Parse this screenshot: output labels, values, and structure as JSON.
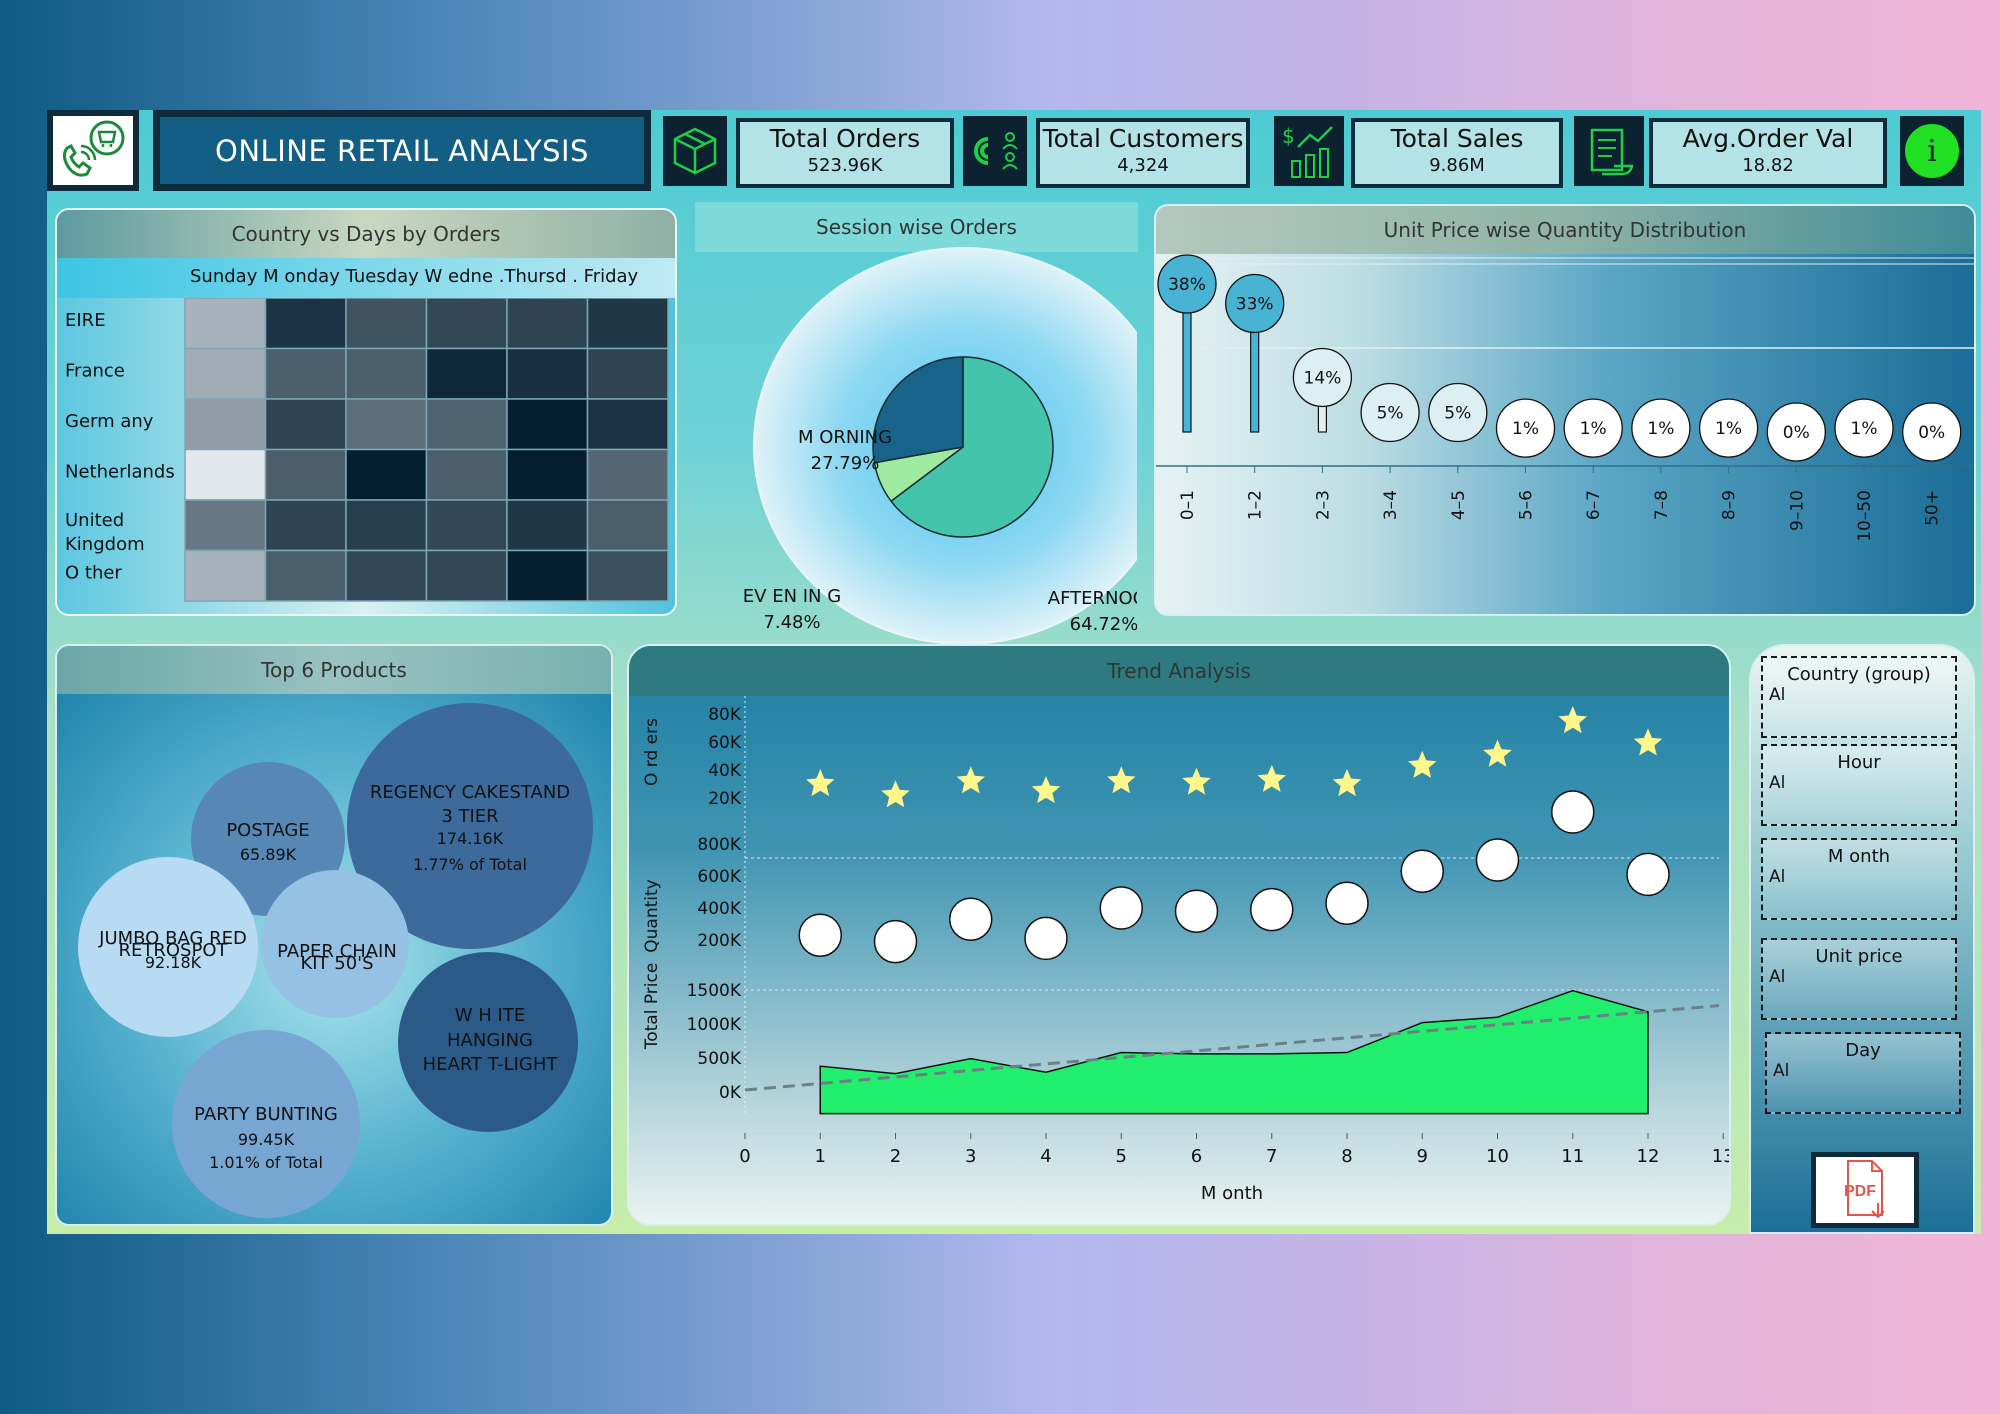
{
  "header": {
    "title": "ONLINE RETAIL ANALYSIS",
    "kpis": [
      {
        "label": "Total Orders",
        "value": "523.96K"
      },
      {
        "label": "Total Customers",
        "value": "4,324"
      },
      {
        "label": "Total Sales",
        "value": "9.86M"
      },
      {
        "label": "Avg.Order Val",
        "value": "18.82"
      }
    ],
    "info_glyph": "i"
  },
  "heatmap": {
    "title": "Country vs Days by Orders",
    "days_header": "Sunday M onday Tuesday W edne .Thursd . Friday",
    "rows": [
      {
        "label": "EIRE",
        "shades": [
          0.3,
          0.9,
          0.75,
          0.8,
          0.82,
          0.88
        ]
      },
      {
        "label": "France",
        "shades": [
          0.33,
          0.7,
          0.7,
          0.95,
          0.92,
          0.82
        ]
      },
      {
        "label": "Germ any",
        "shades": [
          0.4,
          0.82,
          0.62,
          0.68,
          1.0,
          0.9
        ]
      },
      {
        "label": "Netherlands",
        "shades": [
          0.05,
          0.7,
          1.0,
          0.7,
          1.0,
          0.66
        ]
      },
      {
        "label": "United Kingdom",
        "shades": [
          0.58,
          0.82,
          0.85,
          0.8,
          0.88,
          0.7
        ]
      },
      {
        "label": "O ther",
        "shades": [
          0.3,
          0.7,
          0.8,
          0.8,
          1.0,
          0.76
        ]
      }
    ]
  },
  "session": {
    "title": "Session wise Orders",
    "slices": [
      {
        "name": "AFTERNOON",
        "pct": "64.72%",
        "value": 64.72,
        "color": "#45c4ac"
      },
      {
        "name": "EV EN IN G",
        "pct": "7.48%",
        "value": 7.48,
        "color": "#9eeaa0"
      },
      {
        "name": "M ORNING",
        "pct": "27.79%",
        "value": 27.79,
        "color": "#17638a"
      }
    ]
  },
  "unitprice": {
    "title": "Unit Price wise Quantity Distribution",
    "categories": [
      "0–1",
      "1–2",
      "2–3",
      "3–4",
      "4–5",
      "5–6",
      "6–7",
      "7–8",
      "8–9",
      "9–10",
      "10–50",
      "50+"
    ],
    "labels": [
      "38%",
      "33%",
      "14%",
      "5%",
      "5%",
      "1%",
      "1%",
      "1%",
      "1%",
      "0%",
      "1%",
      "0%"
    ],
    "values": [
      38,
      33,
      14,
      5,
      5,
      1,
      1,
      1,
      1,
      0,
      1,
      0
    ]
  },
  "products": {
    "title": "Top 6 Products",
    "items": [
      {
        "name": "POSTAGE",
        "value": "65.89K",
        "pct": ""
      },
      {
        "name": "REGENCY CAKESTAND 3 TIER",
        "value": "174.16K",
        "pct": "1.77% of Total"
      },
      {
        "name": "JUMBO BAG RED RETROSPOT",
        "value": "92.18K",
        "pct": ""
      },
      {
        "name": "PAPER CHAIN KIT 50'S",
        "value": "",
        "pct": ""
      },
      {
        "name": "W H ITE HANGING HEART T-LIGHT",
        "value": "",
        "pct": ""
      },
      {
        "name": "PARTY BUNTING",
        "value": "99.45K",
        "pct": "1.01% of Total"
      }
    ]
  },
  "trend": {
    "title": "Trend Analysis",
    "ylabel_orders": "O rd ers",
    "ylabel_price": "Total Price",
    "ylabel_qty": "Quantity",
    "xlabel": "M onth",
    "x_ticks": [
      "0",
      "1",
      "2",
      "3",
      "4",
      "5",
      "6",
      "7",
      "8",
      "9",
      "10",
      "11",
      "12",
      "13"
    ],
    "orders_ticks": [
      "80K",
      "60K",
      "40K",
      "20K"
    ],
    "price_ticks": [
      "800K",
      "600K",
      "400K",
      "200K"
    ],
    "qty_ticks": [
      "1500K",
      "1000K",
      "500K",
      "0K"
    ]
  },
  "chart_data": [
    {
      "type": "heatmap",
      "title": "Country vs Days by Orders",
      "rows": [
        "EIRE",
        "France",
        "Germ any",
        "Netherlands",
        "United Kingdom",
        "O ther"
      ],
      "columns": [
        "Sunday",
        "M onday",
        "Tuesday",
        "W edne",
        "Thursd",
        "Friday"
      ]
    },
    {
      "type": "pie",
      "title": "Session wise Orders",
      "categories": [
        "AFTERNOON",
        "EV EN IN G",
        "M ORNING"
      ],
      "values": [
        64.72,
        7.48,
        27.79
      ]
    },
    {
      "type": "scatter",
      "title": "Unit Price wise Quantity Distribution",
      "categories": [
        "0–1",
        "1–2",
        "2–3",
        "3–4",
        "4–5",
        "5–6",
        "6–7",
        "7–8",
        "8–9",
        "9–10",
        "10–50",
        "50+"
      ],
      "values": [
        38,
        33,
        14,
        5,
        5,
        1,
        1,
        1,
        1,
        0,
        1,
        0
      ]
    },
    {
      "type": "line",
      "title": "Trend Analysis",
      "xlabel": "M onth",
      "xlim": [
        0,
        13
      ],
      "x": [
        1,
        2,
        3,
        4,
        5,
        6,
        7,
        8,
        9,
        10,
        11,
        12
      ],
      "series": [
        {
          "name": "O rd ers",
          "values": [
            30000,
            22000,
            32000,
            25000,
            32000,
            31000,
            33000,
            30000,
            43000,
            51000,
            75000,
            59000
          ],
          "ylim": [
            10000,
            90000
          ]
        },
        {
          "name": "Total Price",
          "values": [
            230000,
            190000,
            330000,
            210000,
            400000,
            380000,
            390000,
            430000,
            630000,
            700000,
            1000000,
            610000
          ],
          "ylim": [
            0,
            900000
          ]
        },
        {
          "name": "Quantity",
          "values": [
            380000,
            270000,
            490000,
            290000,
            580000,
            560000,
            560000,
            580000,
            1020000,
            1100000,
            1490000,
            1180000
          ],
          "ylim": [
            -500000,
            1700000
          ]
        }
      ]
    }
  ],
  "slicers": [
    {
      "title": "Country (group)",
      "value": "Al"
    },
    {
      "title": "Hour",
      "value": "Al"
    },
    {
      "title": "M onth",
      "value": "Al"
    },
    {
      "title": "Unit price",
      "value": "Al"
    },
    {
      "title": "Day",
      "value": "Al"
    }
  ],
  "export": {
    "label": "PDF"
  },
  "colors": {
    "header_bg": "#0d2b3b",
    "title_bg": "#135e84",
    "kpi_bg": "#b4e3e7",
    "area": "#22ee6d",
    "star": "#fff68c"
  }
}
